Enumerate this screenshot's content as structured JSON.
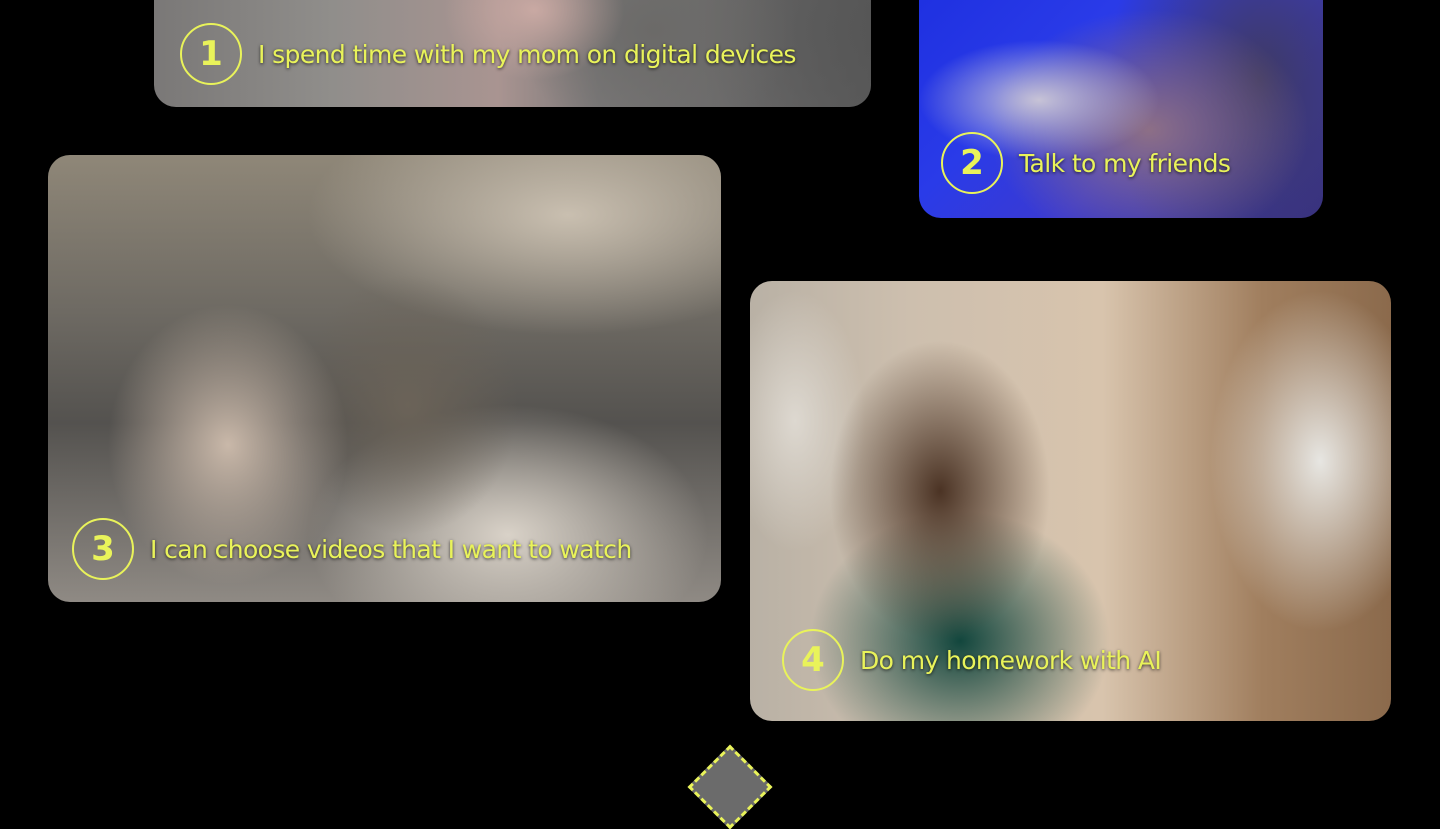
{
  "cards": [
    {
      "number": "1",
      "caption": "I spend time with my mom on digital devices"
    },
    {
      "number": "2",
      "caption": "Talk to my friends"
    },
    {
      "number": "3",
      "caption": "I can choose videos that I want to watch"
    },
    {
      "number": "4",
      "caption": "Do my homework with AI"
    }
  ],
  "colors": {
    "background": "#000000",
    "accent": "#e9f35a"
  }
}
